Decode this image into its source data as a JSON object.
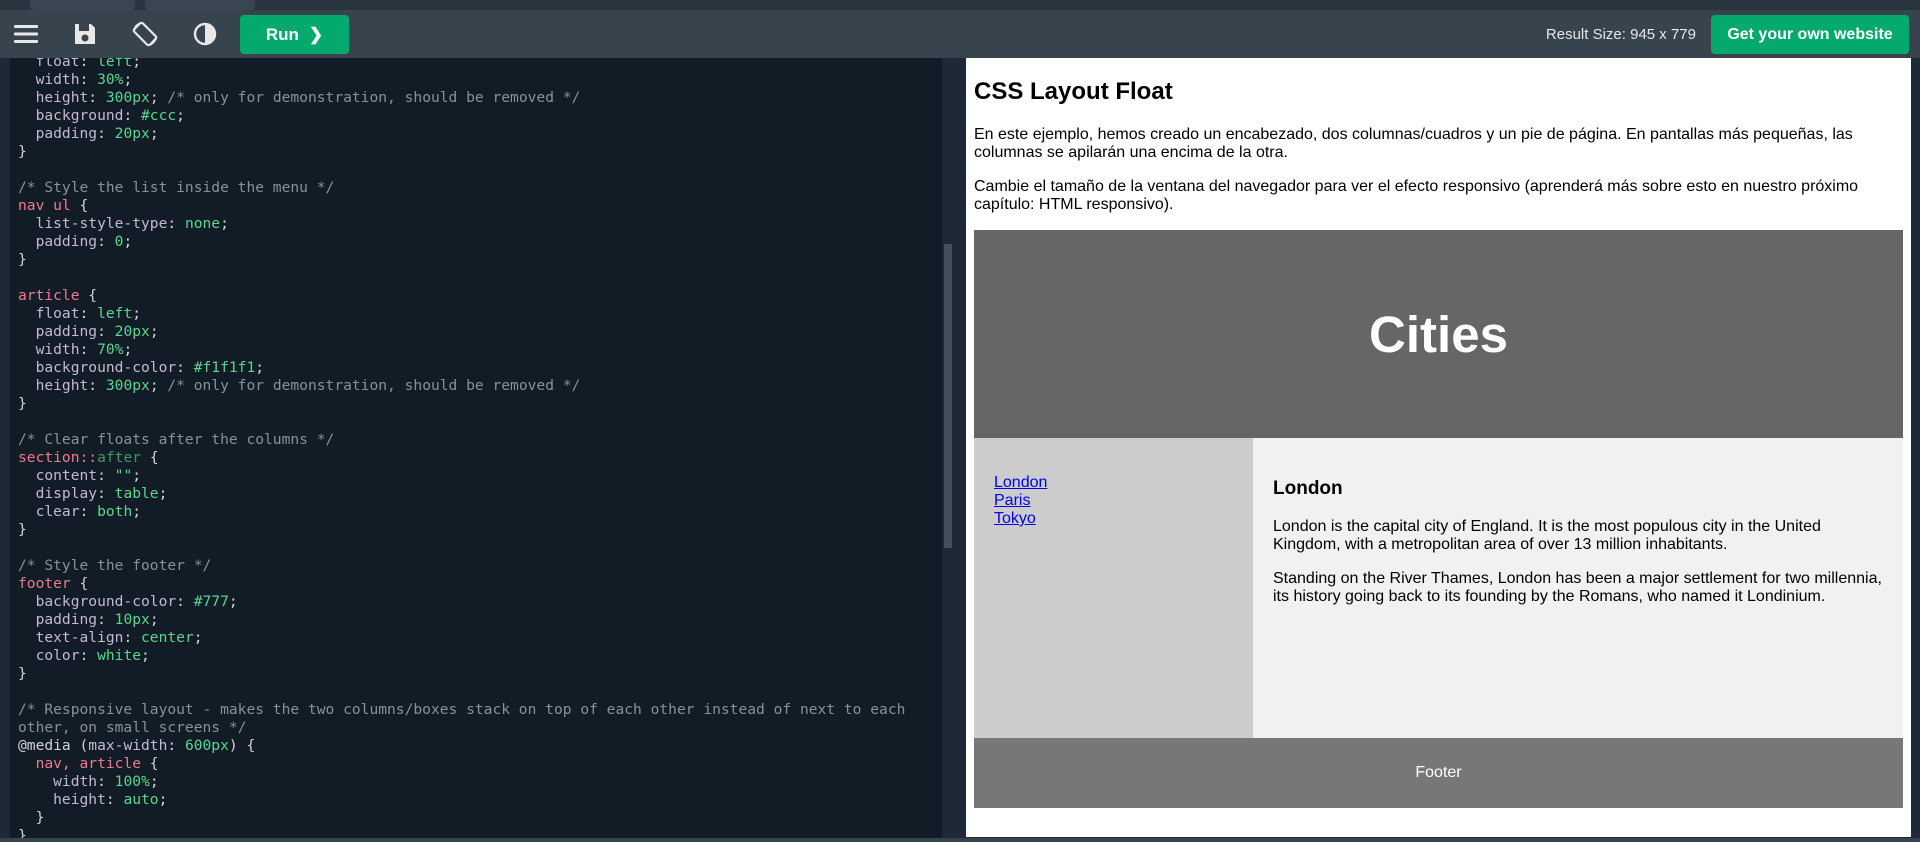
{
  "toolbar": {
    "run_label": "Run",
    "run_chevron": "❯",
    "result_size": "Result Size: 945 x 779",
    "own_website_label": "Get your own website"
  },
  "code_lines": [
    [
      [
        "prop",
        "  float"
      ],
      [
        "",
        ": "
      ],
      [
        "val",
        "left"
      ],
      [
        "",
        ";"
      ]
    ],
    [
      [
        "prop",
        "  width"
      ],
      [
        "",
        ": "
      ],
      [
        "val",
        "30%"
      ],
      [
        "",
        ";"
      ]
    ],
    [
      [
        "prop",
        "  height"
      ],
      [
        "",
        ": "
      ],
      [
        "val",
        "300px"
      ],
      [
        "",
        "; "
      ],
      [
        "cmt",
        "/* only for demonstration, should be removed */"
      ]
    ],
    [
      [
        "prop",
        "  background"
      ],
      [
        "",
        ": "
      ],
      [
        "val",
        "#ccc"
      ],
      [
        "",
        ";"
      ]
    ],
    [
      [
        "prop",
        "  padding"
      ],
      [
        "",
        ": "
      ],
      [
        "val",
        "20px"
      ],
      [
        "",
        ";"
      ]
    ],
    [
      [
        "",
        "}"
      ]
    ],
    [
      [
        "",
        ""
      ]
    ],
    [
      [
        "cmt",
        "/* Style the list inside the menu */"
      ]
    ],
    [
      [
        "sel",
        "nav ul"
      ],
      [
        "",
        " {"
      ]
    ],
    [
      [
        "prop",
        "  list-style-type"
      ],
      [
        "",
        ": "
      ],
      [
        "val",
        "none"
      ],
      [
        "",
        ";"
      ]
    ],
    [
      [
        "prop",
        "  padding"
      ],
      [
        "",
        ": "
      ],
      [
        "val",
        "0"
      ],
      [
        "",
        ";"
      ]
    ],
    [
      [
        "",
        "}"
      ]
    ],
    [
      [
        "",
        ""
      ]
    ],
    [
      [
        "sel",
        "article"
      ],
      [
        "",
        " {"
      ]
    ],
    [
      [
        "prop",
        "  float"
      ],
      [
        "",
        ": "
      ],
      [
        "val",
        "left"
      ],
      [
        "",
        ";"
      ]
    ],
    [
      [
        "prop",
        "  padding"
      ],
      [
        "",
        ": "
      ],
      [
        "val",
        "20px"
      ],
      [
        "",
        ";"
      ]
    ],
    [
      [
        "prop",
        "  width"
      ],
      [
        "",
        ": "
      ],
      [
        "val",
        "70%"
      ],
      [
        "",
        ";"
      ]
    ],
    [
      [
        "prop",
        "  background-color"
      ],
      [
        "",
        ": "
      ],
      [
        "val",
        "#f1f1f1"
      ],
      [
        "",
        ";"
      ]
    ],
    [
      [
        "prop",
        "  height"
      ],
      [
        "",
        ": "
      ],
      [
        "val",
        "300px"
      ],
      [
        "",
        "; "
      ],
      [
        "cmt",
        "/* only for demonstration, should be removed */"
      ]
    ],
    [
      [
        "",
        "}"
      ]
    ],
    [
      [
        "",
        ""
      ]
    ],
    [
      [
        "cmt",
        "/* Clear floats after the columns */"
      ]
    ],
    [
      [
        "sel",
        "section"
      ],
      [
        "sel",
        "::"
      ],
      [
        "pseudo",
        "after"
      ],
      [
        "",
        " {"
      ]
    ],
    [
      [
        "prop",
        "  content"
      ],
      [
        "",
        ": "
      ],
      [
        "val",
        "\"\""
      ],
      [
        "",
        ";"
      ]
    ],
    [
      [
        "prop",
        "  display"
      ],
      [
        "",
        ": "
      ],
      [
        "val",
        "table"
      ],
      [
        "",
        ";"
      ]
    ],
    [
      [
        "prop",
        "  clear"
      ],
      [
        "",
        ": "
      ],
      [
        "val",
        "both"
      ],
      [
        "",
        ";"
      ]
    ],
    [
      [
        "",
        "}"
      ]
    ],
    [
      [
        "",
        ""
      ]
    ],
    [
      [
        "cmt",
        "/* Style the footer */"
      ]
    ],
    [
      [
        "sel",
        "footer"
      ],
      [
        "",
        " {"
      ]
    ],
    [
      [
        "prop",
        "  background-color"
      ],
      [
        "",
        ": "
      ],
      [
        "val",
        "#777"
      ],
      [
        "",
        ";"
      ]
    ],
    [
      [
        "prop",
        "  padding"
      ],
      [
        "",
        ": "
      ],
      [
        "val",
        "10px"
      ],
      [
        "",
        ";"
      ]
    ],
    [
      [
        "prop",
        "  text-align"
      ],
      [
        "",
        ": "
      ],
      [
        "val",
        "center"
      ],
      [
        "",
        ";"
      ]
    ],
    [
      [
        "prop",
        "  color"
      ],
      [
        "",
        ": "
      ],
      [
        "val",
        "white"
      ],
      [
        "",
        ";"
      ]
    ],
    [
      [
        "",
        "}"
      ]
    ],
    [
      [
        "",
        ""
      ]
    ],
    [
      [
        "cmt",
        "/* Responsive layout - makes the two columns/boxes stack on top of each other instead of next to each"
      ]
    ],
    [
      [
        "cmt",
        "other, on small screens */"
      ]
    ],
    [
      [
        "",
        "@media ("
      ],
      [
        "prop",
        "max-width"
      ],
      [
        "",
        ": "
      ],
      [
        "val",
        "600px"
      ],
      [
        "",
        ") {"
      ]
    ],
    [
      [
        "sel",
        "  nav, article"
      ],
      [
        "",
        " {"
      ]
    ],
    [
      [
        "prop",
        "    width"
      ],
      [
        "",
        ": "
      ],
      [
        "val",
        "100%"
      ],
      [
        "",
        ";"
      ]
    ],
    [
      [
        "prop",
        "    height"
      ],
      [
        "",
        ": "
      ],
      [
        "val",
        "auto"
      ],
      [
        "",
        ";"
      ]
    ],
    [
      [
        "",
        "  }"
      ]
    ],
    [
      [
        "",
        "}"
      ]
    ]
  ],
  "result": {
    "title": "CSS Layout Float",
    "intro_1": "En este ejemplo, hemos creado un encabezado, dos columnas/cuadros y un pie de página. En pantallas más pequeñas, las columnas se apilarán una encima de la otra.",
    "intro_2": "Cambie el tamaño de la ventana del navegador para ver el efecto responsivo (aprenderá más sobre esto en nuestro próximo capítulo: HTML responsivo).",
    "header": "Cities",
    "nav_links": [
      "London",
      "Paris",
      "Tokyo"
    ],
    "article_title": "London",
    "article_p1": "London is the capital city of England. It is the most populous city in the United Kingdom, with a metropolitan area of over 13 million inhabitants.",
    "article_p2": "Standing on the River Thames, London has been a major settlement for two millennia, its history going back to its founding by the Romans, who named it Londinium.",
    "footer": "Footer"
  },
  "colors": {
    "accent": "#04aa6d",
    "toolbar": "#38444d",
    "editor_bg": "#111c27"
  },
  "icons": {
    "menu": "menu-icon",
    "save": "save-icon",
    "rotate": "rotate-icon",
    "theme": "contrast-icon"
  }
}
